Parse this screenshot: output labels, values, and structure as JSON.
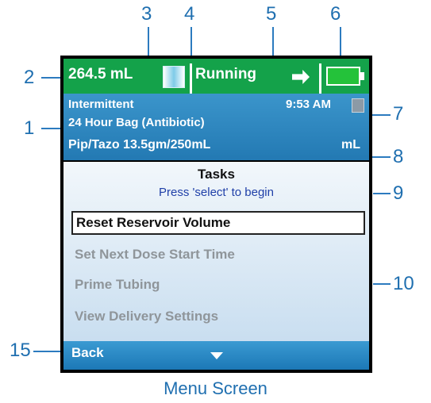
{
  "callouts": [
    "1",
    "2",
    "3",
    "4",
    "5",
    "6",
    "7",
    "8",
    "9",
    "10",
    "15"
  ],
  "status_bar": {
    "volume": "264.5 mL",
    "state": "Running",
    "bg_color": "#14a24a"
  },
  "info": {
    "mode": "Intermittent",
    "time": "9:53 AM",
    "bag": "24 Hour Bag (Antibiotic)",
    "drug": "Pip/Tazo 13.5gm/250mL",
    "units": "mL"
  },
  "tasks": {
    "title": "Tasks",
    "prompt": "Press 'select' to begin",
    "items": [
      {
        "label": "Reset Reservoir Volume",
        "selected": true
      },
      {
        "label": "Set Next Dose Start Time",
        "selected": false
      },
      {
        "label": "Prime Tubing",
        "selected": false
      },
      {
        "label": "View Delivery Settings",
        "selected": false
      }
    ]
  },
  "bottom_bar": {
    "back_label": "Back"
  },
  "caption": "Menu Screen",
  "colors": {
    "accent": "#1f6fb0",
    "panel_blue": "#2379b3"
  }
}
